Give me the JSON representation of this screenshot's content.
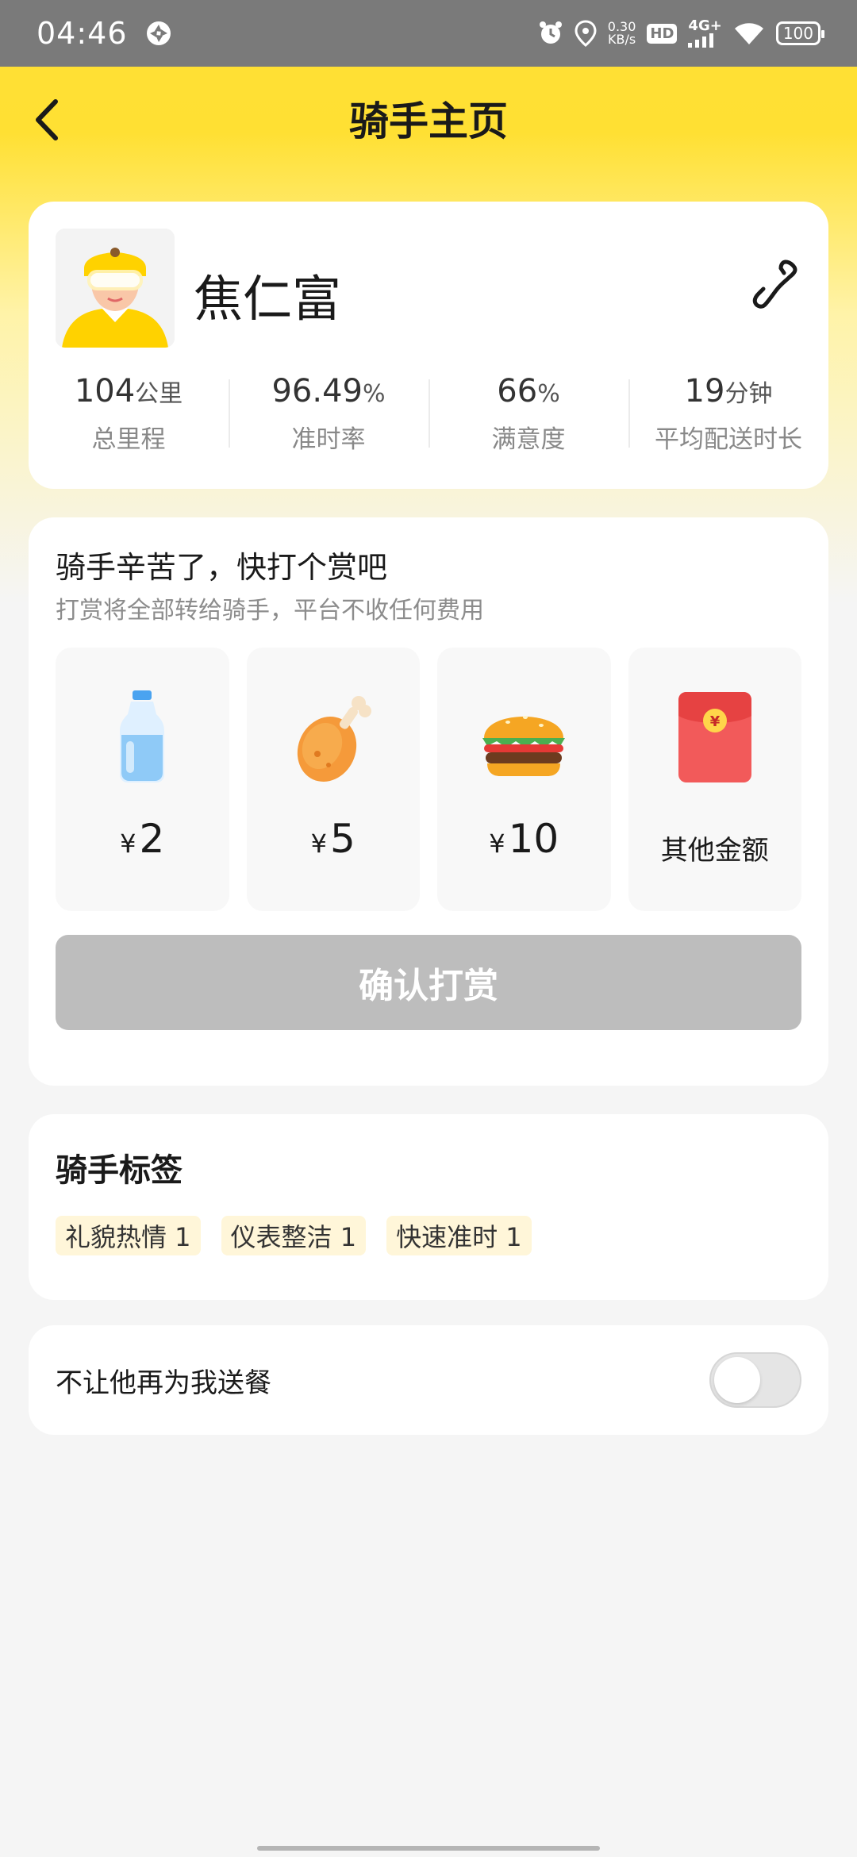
{
  "status_bar": {
    "time": "04:46",
    "net_speed_value": "0.30",
    "net_speed_unit": "KB/s",
    "hd": "HD",
    "network": "4G+",
    "battery": "100",
    "icons": [
      "app-notification-icon",
      "alarm-icon",
      "location-icon",
      "hd-icon",
      "signal-icon",
      "wifi-icon",
      "battery-icon"
    ]
  },
  "header": {
    "title": "骑手主页",
    "back_icon": "chevron-left-icon"
  },
  "profile": {
    "name": "焦仁富",
    "phone_icon": "phone-icon",
    "stats": [
      {
        "value": "104",
        "unit": "公里",
        "label": "总里程"
      },
      {
        "value": "96.49",
        "unit": "%",
        "label": "准时率"
      },
      {
        "value": "66",
        "unit": "%",
        "label": "满意度"
      },
      {
        "value": "19",
        "unit": "分钟",
        "label": "平均配送时长"
      }
    ]
  },
  "tip": {
    "title": "骑手辛苦了，快打个赏吧",
    "subtitle": "打赏将全部转给骑手，平台不收任何费用",
    "currency": "¥",
    "options": [
      {
        "icon": "water-bottle-icon",
        "amount": "2"
      },
      {
        "icon": "chicken-leg-icon",
        "amount": "5"
      },
      {
        "icon": "burger-icon",
        "amount": "10"
      },
      {
        "icon": "red-envelope-icon",
        "label": "其他金额"
      }
    ],
    "confirm_label": "确认打赏"
  },
  "tags_section": {
    "title": "骑手标签",
    "tags": [
      "礼貌热情 1",
      "仪表整洁 1",
      "快速准时 1"
    ]
  },
  "block_setting": {
    "label": "不让他再为我送餐",
    "enabled": false
  },
  "colors": {
    "brand_yellow": "#ffe135",
    "disabled_button": "#bdbdbd",
    "tag_background": "#fff6d9"
  }
}
